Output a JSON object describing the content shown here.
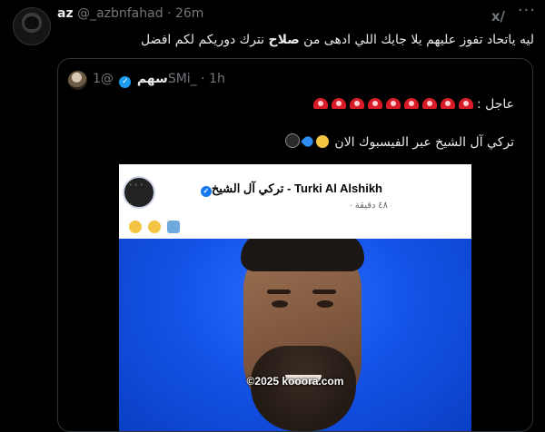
{
  "tweet": {
    "display_name": "az",
    "handle": "@_azbnfahad",
    "separator": "·",
    "time": "26m",
    "grok_label": "x/",
    "more": "···",
    "text_before": "ليه ياتحاد تفوز عليهم يلا جايك اللي ادهى من ",
    "text_bold": "صلاح",
    "text_after": " نترك دوريكم لكم افضل"
  },
  "quote": {
    "display_name": "سهم",
    "handle": "@1SMi_",
    "separator": "·",
    "time": "1h",
    "line1_text": "عاجل :",
    "alarm_count": 9,
    "line2_text": "تركي آل الشيخ عبر الفيسبوك الان",
    "line2_emojis": [
      "shocked-face-icon",
      "blue-heart-icon",
      "bomb-icon"
    ]
  },
  "embedded_image": {
    "page_name": "Turki Al Alshikh - تركي آل الشيخ",
    "meta": "٤٨ دقيقة ·",
    "more": "···",
    "emojis": [
      "sunglasses-face-icon",
      "smiling-face-icon",
      "person-icon"
    ],
    "watermark": "©2025 kooora.com"
  },
  "colors": {
    "background": "#000000",
    "text": "#e7e9ea",
    "muted": "#71767b",
    "verified": "#1d9bf0",
    "border": "#2f3336"
  }
}
